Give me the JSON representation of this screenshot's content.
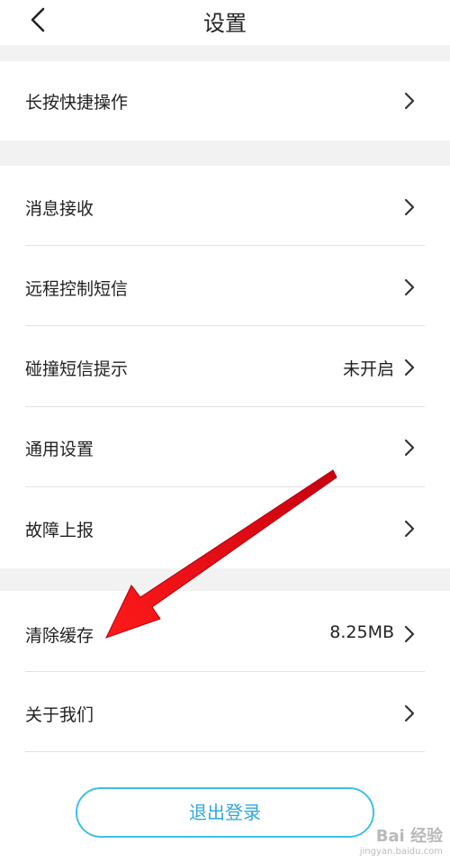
{
  "header": {
    "title": "设置",
    "back_icon": "chevron-left-icon"
  },
  "rows": {
    "shortcut": {
      "label": "长按快捷操作"
    },
    "messages": {
      "label": "消息接收"
    },
    "remote_sms": {
      "label": "远程控制短信"
    },
    "bump_sms": {
      "label": "碰撞短信提示",
      "value": "未开启"
    },
    "general": {
      "label": "通用设置"
    },
    "fault_report": {
      "label": "故障上报"
    },
    "clear_cache": {
      "label": "清除缓存",
      "value": "8.25MB"
    },
    "about": {
      "label": "关于我们"
    }
  },
  "logout": {
    "label": "退出登录"
  },
  "watermark": {
    "main": "Bai 经验",
    "sub": "jingyan.baidu.com"
  },
  "colors": {
    "accent": "#3fbfe6",
    "annotation_arrow": "#e8101a",
    "separator": "#f2f2f2"
  }
}
